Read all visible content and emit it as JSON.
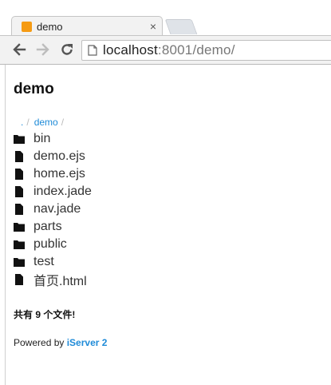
{
  "browser": {
    "tab_title": "demo",
    "tab_close": "×",
    "url_host": "localhost",
    "url_port": ":8001",
    "url_path": "/demo/"
  },
  "page": {
    "title": "demo",
    "breadcrumb": {
      "root": ".",
      "sep1": "/",
      "current": "demo",
      "sep2": "/"
    },
    "files": [
      {
        "name": "bin",
        "type": "folder"
      },
      {
        "name": "demo.ejs",
        "type": "file"
      },
      {
        "name": "home.ejs",
        "type": "file"
      },
      {
        "name": "index.jade",
        "type": "file"
      },
      {
        "name": "nav.jade",
        "type": "file"
      },
      {
        "name": "parts",
        "type": "folder"
      },
      {
        "name": "public",
        "type": "folder"
      },
      {
        "name": "test",
        "type": "folder"
      },
      {
        "name": "首页.html",
        "type": "file"
      }
    ],
    "summary": "共有 9 个文件!",
    "footer": {
      "prefix": "Powered by",
      "brand": "iServer 2"
    }
  },
  "colors": {
    "link": "#1f8bd8",
    "favicon": "#f59b14"
  },
  "icons": {
    "folder": "folder-icon",
    "file": "file-icon"
  }
}
